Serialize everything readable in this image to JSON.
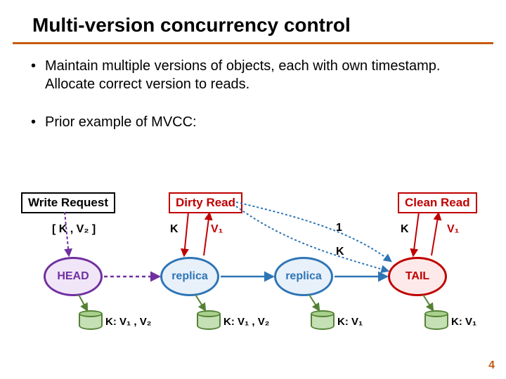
{
  "title": "Multi-version concurrency control",
  "bullets": [
    "Maintain multiple versions of objects, each with own timestamp.  Allocate correct version to reads.",
    "Prior example of MVCC:"
  ],
  "boxes": {
    "write_request": "Write Request",
    "dirty_read": "Dirty Read",
    "clean_read": "Clean Read"
  },
  "nodes": {
    "head": "HEAD",
    "replica1": "replica",
    "replica2": "replica",
    "tail": "TAIL"
  },
  "labels": {
    "write_payload": "[ K , V₂ ]",
    "dirty_k": "K",
    "dirty_v": "V₁",
    "forward_1": "1",
    "forward_k": "K",
    "clean_k": "K",
    "clean_v": "V₁"
  },
  "storage": {
    "head": "K: V₁ , V₂",
    "replica1": "K: V₁ , V₂",
    "replica2": "K: V₁",
    "tail": "K: V₁"
  },
  "page_number": "4",
  "colors": {
    "accent": "#c55a11",
    "head": "#7030a0",
    "replica": "#2e75b6",
    "tail": "#c00000",
    "storage": "#548235"
  }
}
